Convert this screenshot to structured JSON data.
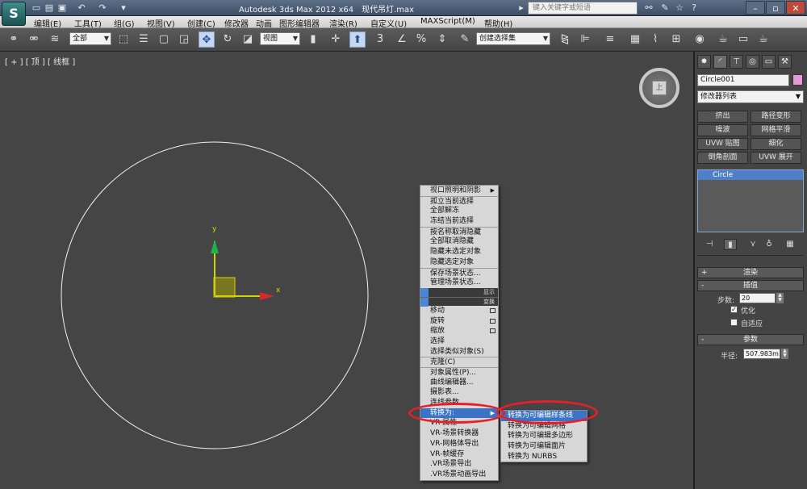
{
  "window": {
    "title": "Autodesk 3ds Max  2012 x64",
    "document": "现代吊灯.max",
    "search_placeholder": "键入关键字或短语"
  },
  "menubar": [
    "编辑(E)",
    "工具(T)",
    "组(G)",
    "视图(V)",
    "创建(C)",
    "修改器",
    "动画",
    "图形编辑器",
    "渲染(R)",
    "自定义(U)",
    "MAXScript(M)",
    "帮助(H)"
  ],
  "toolbar": {
    "selection_filter": "全部",
    "reference_coord": "视图",
    "named_selection": "创建选择集",
    "snap_label": "3"
  },
  "viewport": {
    "label": "[ + ] [ 顶 ] [ 线框 ]",
    "axis_y": "y",
    "axis_x": "x",
    "viewcube_face": "上"
  },
  "quad_menu": {
    "items": [
      {
        "label": "视口照明和阴影",
        "submenu": true
      },
      {
        "label": "孤立当前选择"
      },
      {
        "label": "全部解冻"
      },
      {
        "label": "冻结当前选择"
      },
      {
        "label": "按名称取消隐藏"
      },
      {
        "label": "全部取消隐藏"
      },
      {
        "label": "隐藏未选定对象"
      },
      {
        "label": "隐藏选定对象"
      },
      {
        "label": "保存场景状态..."
      },
      {
        "label": "管理场景状态..."
      }
    ],
    "header_display": "显示",
    "header_transform": "变换",
    "transform_items": [
      {
        "label": "移动",
        "box": true
      },
      {
        "label": "旋转",
        "box": true
      },
      {
        "label": "缩放",
        "box": true
      },
      {
        "label": "选择"
      },
      {
        "label": "选择类似对象(S)"
      },
      {
        "label": "克隆(C)"
      },
      {
        "label": "对象属性(P)..."
      },
      {
        "label": "曲线编辑器..."
      },
      {
        "label": "摄影表..."
      },
      {
        "label": "连线参数..."
      },
      {
        "label": "转换为:",
        "submenu": true,
        "highlight": true
      },
      {
        "label": "VR-属性"
      },
      {
        "label": "VR-场景转换器"
      },
      {
        "label": "VR-网格体导出"
      },
      {
        "label": "VR-帧缓存"
      },
      {
        "label": ".VR场景导出"
      },
      {
        "label": ".VR场景动画导出"
      }
    ]
  },
  "convert_submenu": [
    {
      "label": "转换为可编辑样条线",
      "highlight": true
    },
    {
      "label": "转换为可编辑网格"
    },
    {
      "label": "转换为可编辑多边形"
    },
    {
      "label": "转换为可编辑面片"
    },
    {
      "label": "转换为 NURBS"
    }
  ],
  "command_panel": {
    "object_name": "Circle001",
    "object_color": "#e59ad7",
    "modifier_list": "修改器列表",
    "modifier_buttons": [
      "挤出",
      "路径变形",
      "噪波",
      "网格平滑",
      "UVW 贴图",
      "细化",
      "倒角剖面",
      "UVW 展开"
    ],
    "stack_item": "Circle",
    "rollouts": {
      "render": "渲染",
      "interpolation": "插值",
      "parameters": "参数"
    },
    "steps_label": "步数:",
    "steps_value": "20",
    "optimize_label": "优化",
    "adaptive_label": "自适应",
    "radius_label": "半径:",
    "radius_value": "507.983m"
  }
}
